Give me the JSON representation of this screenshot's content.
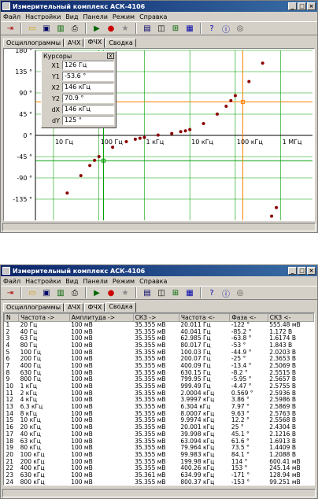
{
  "app": {
    "title": "Измерительный комплекс АСК-4106"
  },
  "menu": [
    "Файл",
    "Настройки",
    "Вид",
    "Панели",
    "Режим",
    "Справка"
  ],
  "tabs": [
    "Осциллограммы",
    "АЧХ",
    "ФЧХ",
    "Сводка"
  ],
  "window1_active_tab": "ФЧХ",
  "window2_active_tab": "Сводка",
  "cursors": {
    "title": "Курсоры",
    "close": "x",
    "rows": [
      {
        "label": "X1",
        "value": "126 Гц"
      },
      {
        "label": "Y1",
        "value": "-53.6 °"
      },
      {
        "label": "X2",
        "value": "146 кГц"
      },
      {
        "label": "Y2",
        "value": "70.9 °"
      },
      {
        "label": "dX",
        "value": "146 кГц"
      },
      {
        "label": "dY",
        "value": "125 °"
      }
    ]
  },
  "chart_data": {
    "type": "scatter",
    "title": "",
    "xlabel": "",
    "ylabel": "",
    "x_scale": "log",
    "xlim": [
      4,
      5000000
    ],
    "ylim": [
      -180,
      180
    ],
    "x_ticks": [
      "10 Гц",
      "100 Гц",
      "1 кГц",
      "10 кГц",
      "100 кГц",
      "1 МГц"
    ],
    "y_ticks": [
      "180 °",
      "135 °",
      "90 °",
      "45 °",
      "0 °",
      "-45 °",
      "-90 °",
      "-135 °"
    ],
    "series": [
      {
        "points": [
          [
            20,
            -122
          ],
          [
            40,
            -85.2
          ],
          [
            63,
            -63.8
          ],
          [
            80,
            -53
          ],
          [
            100,
            -44.9
          ],
          [
            200,
            -25
          ],
          [
            400,
            -13.4
          ],
          [
            630,
            -8.2
          ],
          [
            800,
            -5.95
          ],
          [
            1000,
            -4.47
          ],
          [
            2000,
            0.569
          ],
          [
            4000,
            3.86
          ],
          [
            6300,
            7.97
          ],
          [
            8000,
            9.63
          ],
          [
            10000,
            12.2
          ],
          [
            20000,
            25
          ],
          [
            40000,
            45.1
          ],
          [
            63000,
            61.6
          ],
          [
            80000,
            73.5
          ],
          [
            100000,
            84.1
          ],
          [
            200000,
            114
          ],
          [
            400000,
            153
          ],
          [
            630000,
            -171
          ],
          [
            800000,
            -153
          ]
        ]
      }
    ],
    "cursor_lines": {
      "x1": 126,
      "y1": -53.6,
      "x2": 146000,
      "y2": 70.9
    },
    "grid": true,
    "colors": {
      "points": "#8b0000",
      "grid": "#00a000",
      "cursor": "#ff8000"
    }
  },
  "summary_table": {
    "headers": [
      "N",
      "Частота ->",
      "Амплитуда ->",
      "СКЗ ->",
      "Частота <-",
      "Фаза <-",
      "СКЗ <-"
    ],
    "rows": [
      [
        "1",
        "20 Гц",
        "100 мВ",
        "35.355 мВ",
        "20.011 Гц",
        "-122 °",
        "555.48 мВ"
      ],
      [
        "2",
        "40 Гц",
        "100 мВ",
        "35.355 мВ",
        "40.041 Гц",
        "-85.2 °",
        "1.172 В"
      ],
      [
        "3",
        "63 Гц",
        "100 мВ",
        "35.355 мВ",
        "62.985 Гц",
        "-63.8 °",
        "1.6174 В"
      ],
      [
        "4",
        "80 Гц",
        "100 мВ",
        "35.355 мВ",
        "80.017 Гц",
        "-53 °",
        "1.843 В"
      ],
      [
        "5",
        "100 Гц",
        "100 мВ",
        "35.355 мВ",
        "100.03 Гц",
        "-44.9 °",
        "2.0203 В"
      ],
      [
        "6",
        "200 Гц",
        "100 мВ",
        "35.355 мВ",
        "200.07 Гц",
        "-25 °",
        "2.3653 В"
      ],
      [
        "7",
        "400 Гц",
        "100 мВ",
        "35.355 мВ",
        "400.09 Гц",
        "-13.4 °",
        "2.5069 В"
      ],
      [
        "8",
        "630 Гц",
        "100 мВ",
        "35.355 мВ",
        "630.15 Гц",
        "-8.2 °",
        "2.5515 В"
      ],
      [
        "9",
        "800 Гц",
        "100 мВ",
        "35.355 мВ",
        "799.95 Гц",
        "-5.95 °",
        "2.5657 В"
      ],
      [
        "10",
        "1 кГц",
        "100 мВ",
        "35.355 мВ",
        "999.49 Гц",
        "-4.47 °",
        "2.5755 В"
      ],
      [
        "11",
        "2 кГц",
        "100 мВ",
        "35.355 мВ",
        "2.0004 кГц",
        "0.569 °",
        "2.5936 В"
      ],
      [
        "12",
        "4 кГц",
        "100 мВ",
        "35.355 мВ",
        "3.9997 кГц",
        "3.86 °",
        "2.5986 В"
      ],
      [
        "13",
        "6.3 кГц",
        "100 мВ",
        "35.355 мВ",
        "6.304 кГц",
        "7.97 °",
        "2.5869 В"
      ],
      [
        "14",
        "8 кГц",
        "100 мВ",
        "35.355 мВ",
        "8.0007 кГц",
        "9.63 °",
        "2.5763 В"
      ],
      [
        "15",
        "10 кГц",
        "100 мВ",
        "35.355 мВ",
        "9.9974 кГц",
        "12.2 °",
        "2.5568 В"
      ],
      [
        "16",
        "20 кГц",
        "100 мВ",
        "35.355 мВ",
        "20.001 кГц",
        "25 °",
        "2.4304 В"
      ],
      [
        "17",
        "40 кГц",
        "100 мВ",
        "35.355 мВ",
        "39.998 кГц",
        "45.1 °",
        "2.1216 В"
      ],
      [
        "18",
        "63 кГц",
        "100 мВ",
        "35.355 мВ",
        "63.094 кГц",
        "61.6 °",
        "1.6913 В"
      ],
      [
        "19",
        "80 кГц",
        "100 мВ",
        "35.355 мВ",
        "79.964 кГц",
        "73.5 °",
        "1.4409 В"
      ],
      [
        "20",
        "100 кГц",
        "100 мВ",
        "35.355 мВ",
        "99.983 кГц",
        "84.1 °",
        "1.2088 В"
      ],
      [
        "21",
        "200 кГц",
        "100 мВ",
        "35.355 мВ",
        "199.98 кГц",
        "114 °",
        "600.41 мВ"
      ],
      [
        "22",
        "400 кГц",
        "100 мВ",
        "35.355 мВ",
        "400.26 кГц",
        "153 °",
        "245.14 мВ"
      ],
      [
        "23",
        "630 кГц",
        "100 мВ",
        "35.361 мВ",
        "634.99 кГц",
        "-171 °",
        "128.94 мВ"
      ],
      [
        "24",
        "800 кГц",
        "100 мВ",
        "35.355 мВ",
        "800.37 кГц",
        "-153 °",
        "99.251 мВ"
      ]
    ]
  }
}
